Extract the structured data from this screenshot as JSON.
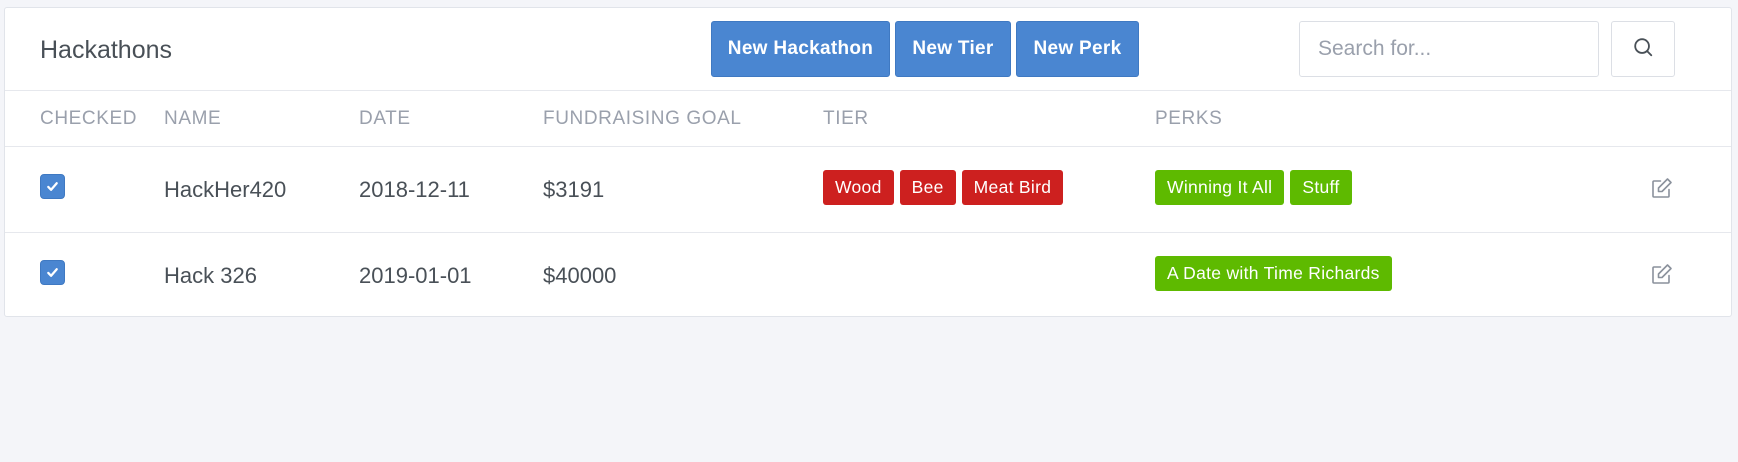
{
  "header": {
    "title": "Hackathons",
    "buttons": {
      "new_hackathon": "New Hackathon",
      "new_tier": "New Tier",
      "new_perk": "New Perk"
    },
    "search": {
      "placeholder": "Search for...",
      "value": "",
      "icon": "search-icon"
    }
  },
  "table": {
    "columns": [
      "CHECKED",
      "NAME",
      "DATE",
      "FUNDRAISING GOAL",
      "TIER",
      "PERKS"
    ],
    "rows": [
      {
        "checked": true,
        "name": "HackHer420",
        "date": "2018-12-11",
        "goal": "$3191",
        "tiers": [
          "Wood",
          "Bee",
          "Meat Bird"
        ],
        "perks": [
          "Winning It All",
          "Stuff"
        ],
        "action_icon": "edit-icon"
      },
      {
        "checked": true,
        "name": "Hack 326",
        "date": "2019-01-01",
        "goal": "$40000",
        "tiers": [],
        "perks": [
          "A Date with Time Richards"
        ],
        "action_icon": "edit-icon"
      }
    ]
  },
  "colors": {
    "primary": "#4a86d1",
    "tier_badge": "#cd201f",
    "perk_badge": "#5eba00",
    "page_background": "#f4f5f9"
  }
}
